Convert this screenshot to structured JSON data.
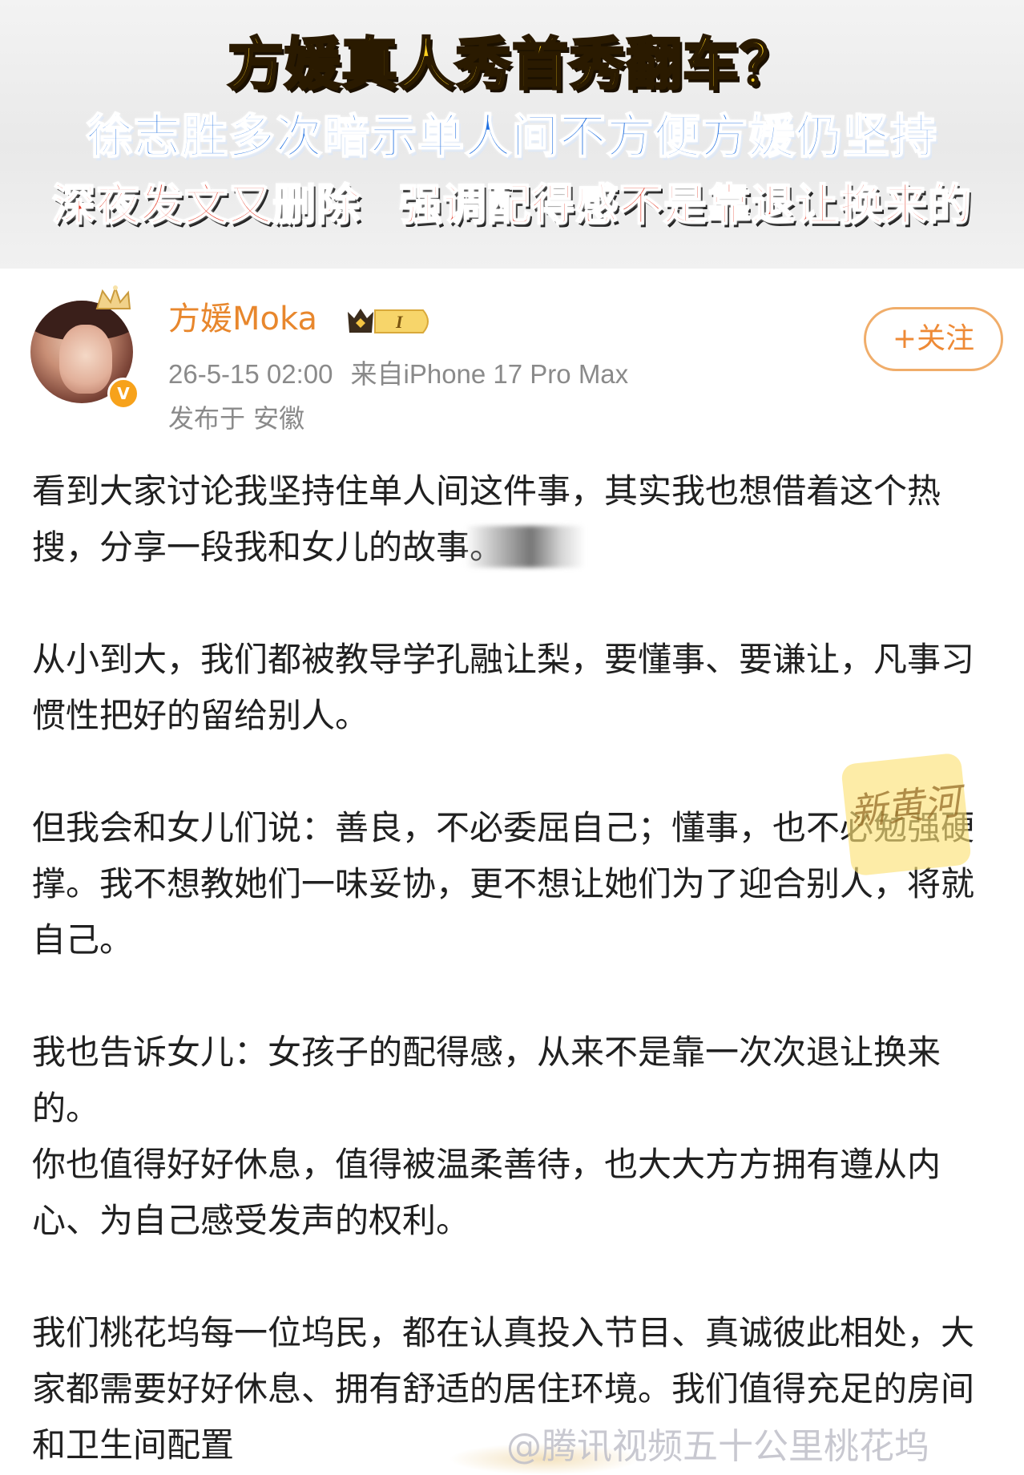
{
  "banner": {
    "headline_1": "方媛真人秀首秀翻车？",
    "headline_2": "徐志胜多次暗示单人间不方便方媛仍坚持",
    "headline_3": "深夜发文又删除 强调配得感不是靠退让换来的"
  },
  "post": {
    "username": "方媛Moka",
    "vip_level": "I",
    "timestamp": "26-5-15 02:00",
    "source": "来自iPhone 17 Pro Max",
    "location": "发布于 安徽",
    "follow_label": "+关注",
    "verified_mark": "V",
    "paragraphs": [
      "看到大家讨论我坚持住单人间这件事，其实我也想借着这个热搜，分享一段我和女儿的故事。",
      "从小到大，我们都被教导学孔融让梨，要懂事、要谦让，凡事习惯性把好的留给别人。",
      "但我会和女儿们说：善良，不必委屈自己；懂事，也不必勉强硬撑。我不想教她们一味妥协，更不想让她们为了迎合别人，将就自己。",
      "我也告诉女儿：女孩子的配得感，从来不是靠一次次退让换来的。",
      "你也值得好好休息，值得被温柔善待，也大大方方拥有遵从内心、为自己感受发声的权利。",
      "我们桃花坞每一位坞民，都在认真投入节目、真诚彼此相处，大家都需要好好休息、拥有舒适的居住环境。我们值得充足的房间和卫生间配置"
    ],
    "mention": "@腾讯视频五十公里桃花坞"
  },
  "watermark_text": "新黄河",
  "colors": {
    "username": "#e8872d",
    "follow": "#ee8a36",
    "headline_yellow": "#ffd21f",
    "headline_blue": "#1f6fe0",
    "headline_red": "#e43d2b"
  }
}
